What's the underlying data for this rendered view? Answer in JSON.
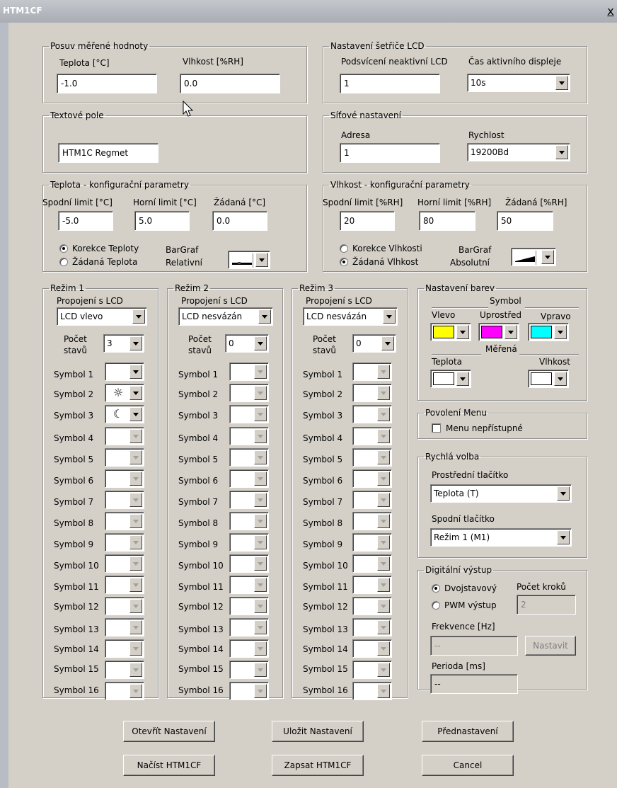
{
  "window": {
    "title": "HTM1CF",
    "close": "x"
  },
  "offset": {
    "legend": "Posuv měřené hodnoty",
    "temp_label": "Teplota [°C]",
    "temp_value": "-1.0",
    "hum_label": "Vlhkost [%RH]",
    "hum_value": "0.0"
  },
  "saver": {
    "legend": "Nastavení šetřiče LCD",
    "backlight_label": "Podsvícení neaktivní LCD",
    "backlight_value": "1",
    "time_label": "Čas aktivního displeje",
    "time_value": "10s"
  },
  "text_field": {
    "legend": "Textové pole",
    "value": "HTM1C Regmet"
  },
  "network": {
    "legend": "Síťové nastavení",
    "address_label": "Adresa",
    "address_value": "1",
    "speed_label": "Rychlost",
    "speed_value": "19200Bd"
  },
  "temp_config": {
    "legend": "Teplota - konfigurační parametry",
    "low_label": "Spodní limit [°C]",
    "low_value": "-5.0",
    "high_label": "Horní limit [°C]",
    "high_value": "5.0",
    "set_label": "Žádaná [°C]",
    "set_value": "0.0",
    "radio1": "Korekce Teploty",
    "radio2": "Žádaná Teplota",
    "bargraph_label1": "BarGraf",
    "bargraph_label2": "Relativní",
    "selected": "radio1"
  },
  "hum_config": {
    "legend": "Vlhkost - konfigurační parametry",
    "low_label": "Spodní limit [%RH]",
    "low_value": "20",
    "high_label": "Horní limit [%RH]",
    "high_value": "80",
    "set_label": "Žádaná [%RH]",
    "set_value": "50",
    "radio1": "Korekce Vlhkosti",
    "radio2": "Žádaná Vlhkost",
    "bargraph_label1": "BarGraf",
    "bargraph_label2": "Absolutní",
    "selected": "radio2"
  },
  "modes": [
    {
      "legend": "Režim 1",
      "link_label": "Propojení s LCD",
      "link_value": "LCD vlevo",
      "count_label1": "Počet",
      "count_label2": "stavů",
      "count_value": "3",
      "symbols": [
        "",
        "☼",
        "☾"
      ]
    },
    {
      "legend": "Režim 2",
      "link_label": "Propojení s LCD",
      "link_value": "LCD nesvázán",
      "count_label1": "Počet",
      "count_label2": "stavů",
      "count_value": "0",
      "symbols": []
    },
    {
      "legend": "Režim 3",
      "link_label": "Propojení s LCD",
      "link_value": "LCD nesvázán",
      "count_label1": "Počet",
      "count_label2": "stavů",
      "count_value": "0",
      "symbols": []
    }
  ],
  "symbol_labels": [
    "Symbol 1",
    "Symbol 2",
    "Symbol 3",
    "Symbol 4",
    "Symbol 5",
    "Symbol 6",
    "Symbol 7",
    "Symbol 8",
    "Symbol 9",
    "Symbol 10",
    "Symbol 11",
    "Symbol 12",
    "Symbol 13",
    "Symbol 14",
    "Symbol 15",
    "Symbol 16"
  ],
  "colors": {
    "legend": "Nastavení barev",
    "symbol_label": "Symbol",
    "left_label": "Vlevo",
    "middle_label": "Uprostřed",
    "right_label": "Vpravo",
    "measured_label": "Měřená",
    "temp_label": "Teplota",
    "hum_label": "Vlhkost",
    "left_color": "#ffff00",
    "middle_color": "#ff00ff",
    "right_color": "#00ffff",
    "temp_color": "#ffffff",
    "hum_color": "#ffffff"
  },
  "menu": {
    "legend": "Povolení Menu",
    "checkbox_label": "Menu nepřístupné"
  },
  "quick": {
    "legend": "Rychlá volba",
    "middle_label": "Prostřední tlačítko",
    "middle_value": "Teplota (T)",
    "bottom_label": "Spodní tlačítko",
    "bottom_value": "Režim 1 (M1)"
  },
  "digital": {
    "legend": "Digitální výstup",
    "radio1": "Dvojstavový",
    "radio2": "PWM výstup",
    "steps_label": "Počet kroků",
    "steps_value": "2",
    "freq_label": "Frekvence [Hz]",
    "freq_value": "--",
    "set_button": "Nastavit",
    "period_label": "Perioda [ms]",
    "period_value": "--"
  },
  "buttons": {
    "open": "Otevřít Nastavení",
    "save": "Uložit Nastavení",
    "preset": "Přednastavení",
    "load": "Načíst HTM1CF",
    "write": "Zapsat HTM1CF",
    "cancel": "Cancel"
  }
}
